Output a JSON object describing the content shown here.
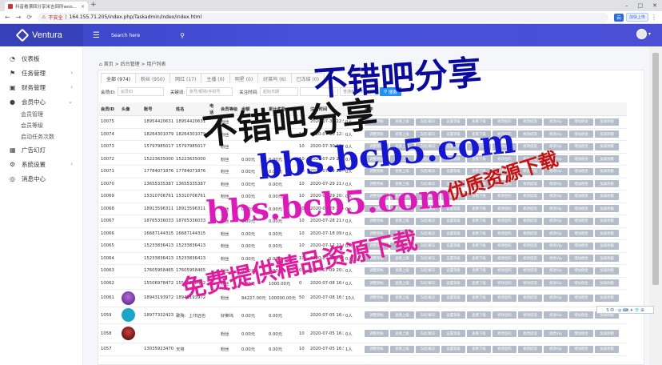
{
  "browser": {
    "tab_title": "抖音看漂回分享米吉回所woo...",
    "tab_close": "×",
    "new_tab": "+",
    "security": "不安全",
    "url": "164.155.71.205/index.php/Taskadmin/index/index.html",
    "ext_label": "云",
    "ext_login": "加快上传",
    "window_controls": [
      "–",
      "□",
      "✕"
    ]
  },
  "header": {
    "brand": "Ventura",
    "search_placeholder": "Search here"
  },
  "sidebar": {
    "items": [
      {
        "label": "仪表板",
        "icon": "dashboard-icon",
        "glyph": "◔",
        "arrow": ""
      },
      {
        "label": "任务管理",
        "icon": "flag-icon",
        "glyph": "⚑",
        "arrow": "›"
      },
      {
        "label": "财务管理",
        "icon": "wallet-icon",
        "glyph": "▣",
        "arrow": "›"
      },
      {
        "label": "会员中心",
        "icon": "user-icon",
        "glyph": "●",
        "arrow": "⌄"
      },
      {
        "label": "广告幻灯",
        "icon": "grid-icon",
        "glyph": "▦",
        "arrow": ""
      },
      {
        "label": "系统设置",
        "icon": "gear-icon",
        "glyph": "⚙",
        "arrow": "›"
      },
      {
        "label": "消息中心",
        "icon": "message-icon",
        "glyph": "◎",
        "arrow": ""
      }
    ],
    "sub_items": [
      "会员管理",
      "会员等级",
      "启动任务次数"
    ]
  },
  "breadcrumb": "首页 > 后台管理 > 用户列表",
  "tabs": [
    "全部 (974)",
    "粉丝 (950)",
    "网红 (17)",
    "主播 (0)",
    "明星 (0)",
    "好莱坞 (6)",
    "已冻结 (0)"
  ],
  "filters": {
    "id_label": "会员ID:",
    "id_placeholder": "会员ID",
    "kw_label": "关键词:",
    "kw_placeholder": "账号/昵称/手机号",
    "time_label": "关注时间:",
    "start_placeholder": "起始日期",
    "sort_placeholder": "普通用户排序",
    "search_btn": "搜索"
  },
  "table": {
    "headers": [
      "会员ID",
      "头像",
      "账号",
      "姓名",
      "电话",
      "会员等级",
      "余额",
      "累计奖励",
      "",
      "注册时间",
      "",
      "操作"
    ],
    "op_buttons": [
      "调整到帐",
      "查看上级",
      "冻结/解冻",
      "设置等级",
      "查看下级",
      "修改密码",
      "修改提现",
      "修改Vip",
      "增加佣金",
      "加减余额"
    ],
    "rows": [
      {
        "id": "10075",
        "avatar": "",
        "account": "18954420631",
        "name": "18954420631",
        "phone": "",
        "level": "粉丝",
        "balance": "",
        "reward": "",
        "n": "10",
        "date": "2020-07-30 12:53",
        "state": "0人"
      },
      {
        "id": "10074",
        "avatar": "",
        "account": "18264301079",
        "name": "18264301079",
        "phone": "",
        "level": "粉丝",
        "balance": "",
        "reward": "",
        "n": "10",
        "date": "2020-07-30 12:10",
        "state": "0人"
      },
      {
        "id": "10073",
        "avatar": "",
        "account": "15797985017",
        "name": "15797985017",
        "phone": "",
        "level": "粉丝",
        "balance": "",
        "reward": "",
        "n": "10",
        "date": "2020-07-30 11:02",
        "state": "0人"
      },
      {
        "id": "10072",
        "avatar": "",
        "account": "15223635000",
        "name": "15223635000",
        "phone": "",
        "level": "粉丝",
        "balance": "0.00元",
        "reward": "0.00元",
        "n": "10",
        "date": "2020-07-29 22:55",
        "state": "0人"
      },
      {
        "id": "10071",
        "avatar": "",
        "account": "17784071876",
        "name": "17784071876",
        "phone": "",
        "level": "粉丝",
        "balance": "0.00元",
        "reward": "0.00元",
        "n": "10",
        "date": "2020-07-29 22:18",
        "state": "0人"
      },
      {
        "id": "10070",
        "avatar": "",
        "account": "13655335387",
        "name": "13655335387",
        "phone": "",
        "level": "粉丝",
        "balance": "0.00元",
        "reward": "0.00元",
        "n": "10",
        "date": "2020-07-29 21:07",
        "state": "0人"
      },
      {
        "id": "10069",
        "avatar": "",
        "account": "15310706761",
        "name": "15310706761",
        "phone": "",
        "level": "粉丝",
        "balance": "0.00元",
        "reward": "0.00元",
        "n": "10",
        "date": "2020-07-29 20:13",
        "state": "0人"
      },
      {
        "id": "10068",
        "avatar": "",
        "account": "18913596311",
        "name": "18913596311",
        "phone": "",
        "level": "粉丝",
        "balance": "0.00元",
        "reward": "0.00元",
        "n": "10",
        "date": "2020-07-28 22:44",
        "state": "0人"
      },
      {
        "id": "10067",
        "avatar": "",
        "account": "18765336033",
        "name": "18765336033",
        "phone": "",
        "level": "粉丝",
        "balance": "0.00元",
        "reward": "0.00元",
        "n": "10",
        "date": "2020-07-28 21:05",
        "state": "0人"
      },
      {
        "id": "10066",
        "avatar": "",
        "account": "16687144315",
        "name": "16687144315",
        "phone": "",
        "level": "粉丝",
        "balance": "0.00元",
        "reward": "0.00元",
        "n": "10",
        "date": "2020-07-18 09:00",
        "state": "0人"
      },
      {
        "id": "10065",
        "avatar": "",
        "account": "15233836413",
        "name": "15233836413",
        "phone": "",
        "level": "粉丝",
        "balance": "0.00元",
        "reward": "0.00元",
        "n": "10",
        "date": "2020-07-17 21:07",
        "state": "0人"
      },
      {
        "id": "10064",
        "avatar": "",
        "account": "15233836413",
        "name": "15233836413",
        "phone": "",
        "level": "粉丝",
        "balance": "0.00元",
        "reward": "0.00元",
        "n": "10",
        "date": "2020-07-15 21:56",
        "state": "0人"
      },
      {
        "id": "10063",
        "avatar": "",
        "account": "17605958465",
        "name": "17605958465",
        "phone": "",
        "level": "粉丝",
        "balance": "0.00元",
        "reward": "0.00元",
        "n": "0",
        "date": "2020-07-09 20:26",
        "state": "0人"
      },
      {
        "id": "10062",
        "avatar": "",
        "account": "15506978472",
        "name": "15506978472",
        "phone": "",
        "level": "粉丝",
        "balance": "0.00元",
        "reward": "1000.00元",
        "n": "0",
        "date": "2020-07-08 16:07",
        "state": "0人"
      },
      {
        "id": "10061",
        "avatar": "t1",
        "account": "18943193972",
        "name": "18943193972",
        "phone": "",
        "level": "粉丝",
        "balance": "84227.00元",
        "reward": "100000.00元",
        "n": "50",
        "date": "2020-07-08 16:55",
        "state": "10人"
      },
      {
        "id": "1059",
        "avatar": "t2",
        "account": "18977332423",
        "name": "歌殇：上印远也",
        "phone": "",
        "level": "好莱坞",
        "balance": "0.00元",
        "reward": "0.00元",
        "n": "",
        "date": "2020-07-05 16:46",
        "state": "0人"
      },
      {
        "id": "1058",
        "avatar": "t3",
        "account": "",
        "name": "",
        "phone": "",
        "level": "粉丝",
        "balance": "0.00元",
        "reward": "0.00元",
        "n": "10",
        "date": "2020-07-05 16:22",
        "state": "0人"
      },
      {
        "id": "1057",
        "avatar": "",
        "account": "13035923470",
        "name": "天将",
        "phone": "",
        "level": "粉丝",
        "balance": "0.00元",
        "reward": "0.00元",
        "n": "10",
        "date": "2020-07-05 16:54",
        "state": "1人"
      }
    ]
  },
  "watermarks": [
    "不错吧分享",
    "不错吧分享",
    "bbs.bcb5.com",
    "bbs.bcb5.com",
    "优质资源下载",
    "免费提供精品资源下载"
  ],
  "float_toolbar": "S 中 · ◎ ⌨ ✦ 👕 ⊞"
}
